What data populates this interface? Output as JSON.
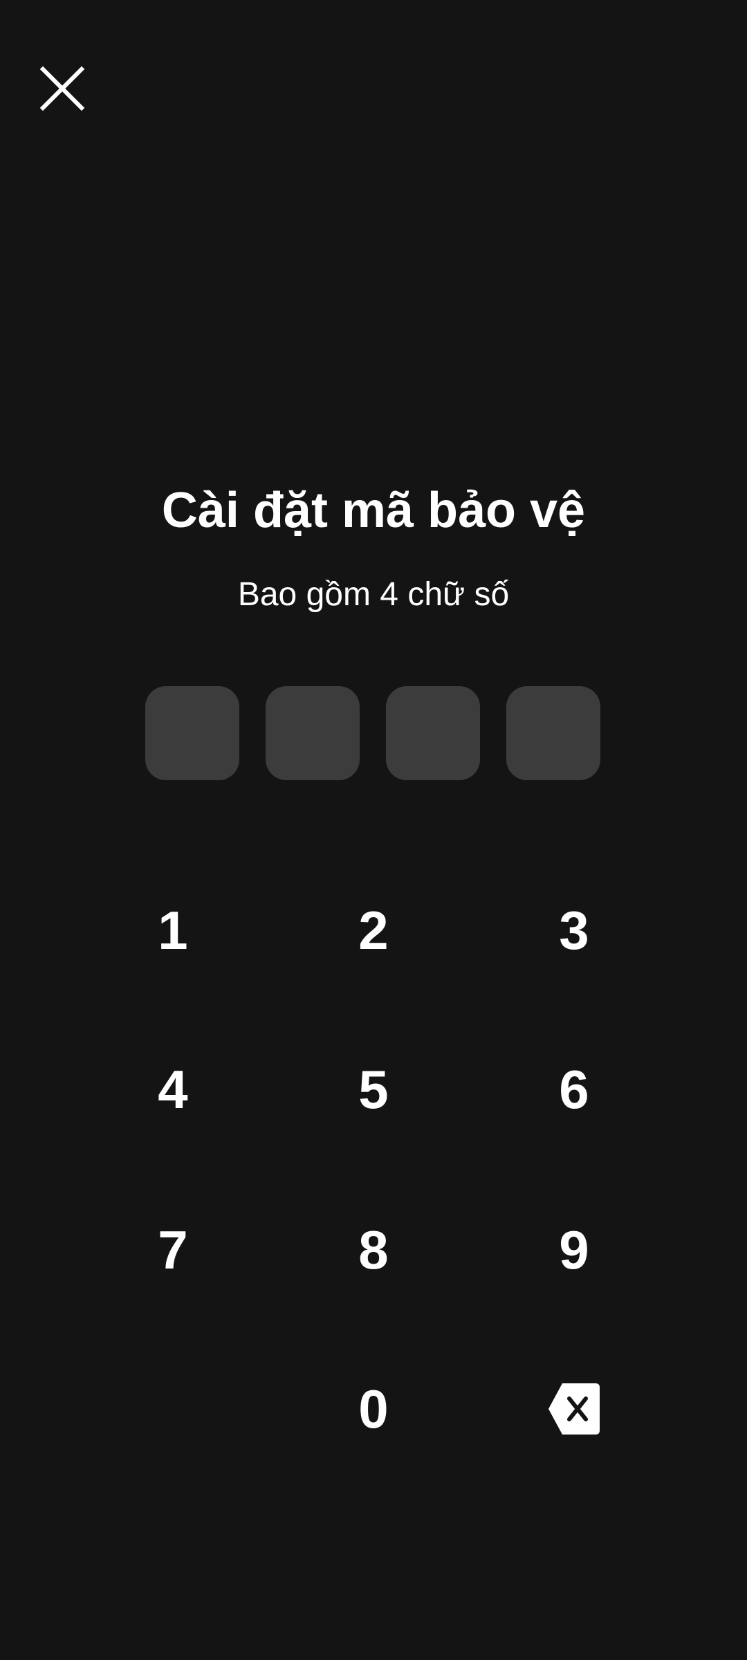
{
  "header": {
    "close_icon": "close-icon"
  },
  "title": "Cài đặt mã bảo vệ",
  "subtitle": "Bao gồm 4 chữ số",
  "pin": {
    "length": 4,
    "entered": ""
  },
  "keypad": {
    "keys": [
      "1",
      "2",
      "3",
      "4",
      "5",
      "6",
      "7",
      "8",
      "9",
      "0"
    ],
    "backspace_icon": "backspace-icon"
  },
  "colors": {
    "background": "#141414",
    "pin_box": "#3c3c3c",
    "text": "#ffffff"
  }
}
